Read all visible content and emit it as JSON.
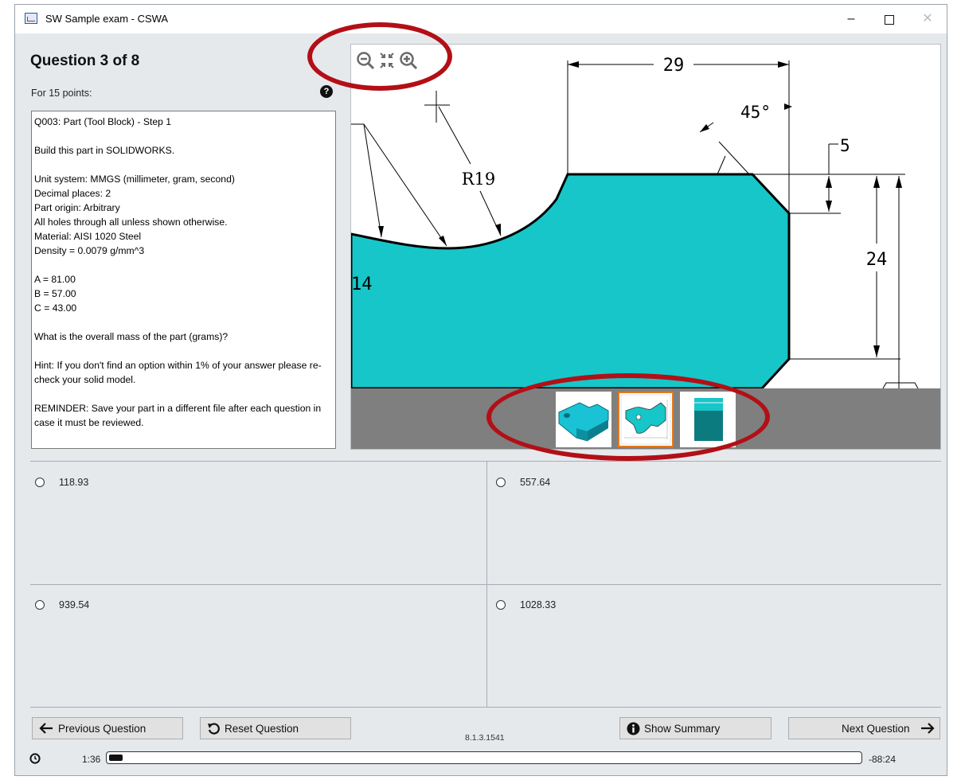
{
  "window": {
    "title": "SW Sample exam - CSWA",
    "minimize_glyph": "–",
    "close_glyph": "✕"
  },
  "question": {
    "heading": "Question 3 of 8",
    "points": "For 15 points:",
    "help_glyph": "?",
    "text": "Q003: Part (Tool Block) - Step 1\n\nBuild this part in SOLIDWORKS.\n\nUnit system: MMGS (millimeter, gram, second)\nDecimal places: 2\nPart origin: Arbitrary\nAll holes through all unless shown otherwise.\nMaterial: AISI 1020 Steel\nDensity = 0.0079 g/mm^3\n\nA = 81.00\nB = 57.00\nC = 43.00\n\nWhat is the overall mass of the part (grams)?\n\nHint: If you don't find an option within 1% of your answer please re-check your solid model.\n\nREMINDER: Save your part in a different file after each question in case it must be reviewed."
  },
  "drawing": {
    "dimensions": {
      "width_top": "29",
      "angle": "45°",
      "chamfer": "5",
      "height_right": "24",
      "radius": "R19",
      "partial_left": "14"
    },
    "fill_color": "#17c6c8"
  },
  "answers": [
    {
      "label": "118.93"
    },
    {
      "label": "557.64"
    },
    {
      "label": "939.54"
    },
    {
      "label": "1028.33"
    }
  ],
  "footer": {
    "prev_label": "Previous Question",
    "reset_label": "Reset Question",
    "summary_label": "Show Summary",
    "next_label": "Next Question",
    "version": "8.1.3.1541",
    "elapsed": "1:36",
    "remaining": "-88:24",
    "progress_fraction": 0.018
  },
  "highlight_color": "#b30f16",
  "icons": [
    "app-icon",
    "help-icon",
    "zoom-out-icon",
    "fit-view-icon",
    "zoom-in-icon",
    "arrow-left-icon",
    "undo-icon",
    "info-icon",
    "arrow-right-icon",
    "clock-icon"
  ]
}
